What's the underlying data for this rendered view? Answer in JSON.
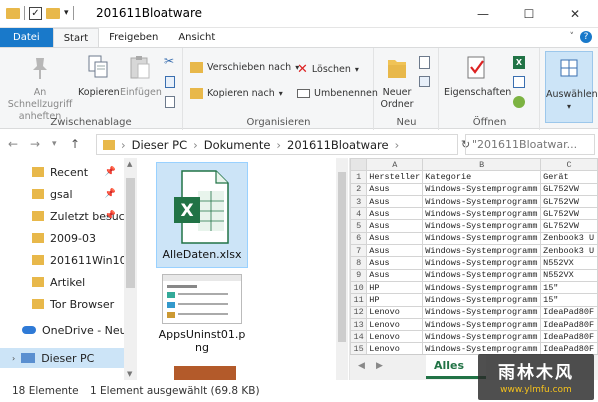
{
  "window": {
    "title": "201611Bloatware",
    "minimize": "—",
    "maximize": "☐",
    "close": "✕"
  },
  "ribbon_tabs": [
    "Datei",
    "Start",
    "Freigeben",
    "Ansicht"
  ],
  "ribbon": {
    "pin_label": "An Schnellzugriff anheften",
    "copy_label": "Kopieren",
    "paste_label": "Einfügen",
    "clipboard_group": "Zwischenablage",
    "move_to": "Verschieben nach",
    "copy_to": "Kopieren nach",
    "delete": "Löschen",
    "rename": "Umbenennen",
    "organize_group": "Organisieren",
    "new_folder": "Neuer Ordner",
    "new_group": "Neu",
    "properties": "Eigenschaften",
    "open_group": "Öffnen",
    "select": "Auswählen"
  },
  "address": {
    "crumbs": [
      "Dieser PC",
      "Dokumente",
      "201611Bloatware"
    ],
    "search_placeholder": "\"201611Bloatwar..."
  },
  "nav_items": [
    {
      "label": "Recent",
      "pinned": true
    },
    {
      "label": "gsal",
      "pinned": true
    },
    {
      "label": "Zuletzt besuch",
      "pinned": true
    },
    {
      "label": "2009-03",
      "pinned": false
    },
    {
      "label": "201611Win10Re",
      "pinned": false
    },
    {
      "label": "Artikel",
      "pinned": false
    },
    {
      "label": "Tor Browser",
      "pinned": false
    },
    {
      "label": "OneDrive - Neue",
      "pinned": false
    },
    {
      "label": "Dieser PC",
      "pinned": false
    }
  ],
  "files": [
    {
      "name": "AlleDaten.xlsx",
      "selected": true
    },
    {
      "name": "AppsUninst01.png",
      "selected": false
    }
  ],
  "preview": {
    "columns": [
      "A",
      "B",
      "C"
    ],
    "header": [
      "Hersteller",
      "Kategorie",
      "Gerät"
    ],
    "rows": [
      [
        "Asus",
        "Windows-Systemprogramm",
        "GL752VW"
      ],
      [
        "Asus",
        "Windows-Systemprogramm",
        "GL752VW"
      ],
      [
        "Asus",
        "Windows-Systemprogramm",
        "GL752VW"
      ],
      [
        "Asus",
        "Windows-Systemprogramm",
        "GL752VW"
      ],
      [
        "Asus",
        "Windows-Systemprogramm",
        "Zenbook3 U"
      ],
      [
        "Asus",
        "Windows-Systemprogramm",
        "Zenbook3 U"
      ],
      [
        "Asus",
        "Windows-Systemprogramm",
        "N552VX"
      ],
      [
        "Asus",
        "Windows-Systemprogramm",
        "N552VX"
      ],
      [
        "HP",
        "Windows-Systemprogramm",
        "15\""
      ],
      [
        "HP",
        "Windows-Systemprogramm",
        "15\""
      ],
      [
        "Lenovo",
        "Windows-Systemprogramm",
        "IdeaPad80F"
      ],
      [
        "Lenovo",
        "Windows-Systemprogramm",
        "IdeaPad80F"
      ],
      [
        "Lenovo",
        "Windows-Systemprogramm",
        "IdeaPad80F"
      ],
      [
        "Lenovo",
        "Windows-Systemprogramm",
        "IdeaPad80F"
      ]
    ],
    "sheet_tab": "Alles"
  },
  "status": {
    "count": "18 Elemente",
    "selection": "1 Element ausgewählt (69.8 KB)"
  },
  "watermark": {
    "title": "雨林木风",
    "url": "www.ylmfu.com"
  },
  "colors": {
    "accent": "#1979ca",
    "excel": "#217346",
    "folder": "#e8b84a"
  }
}
